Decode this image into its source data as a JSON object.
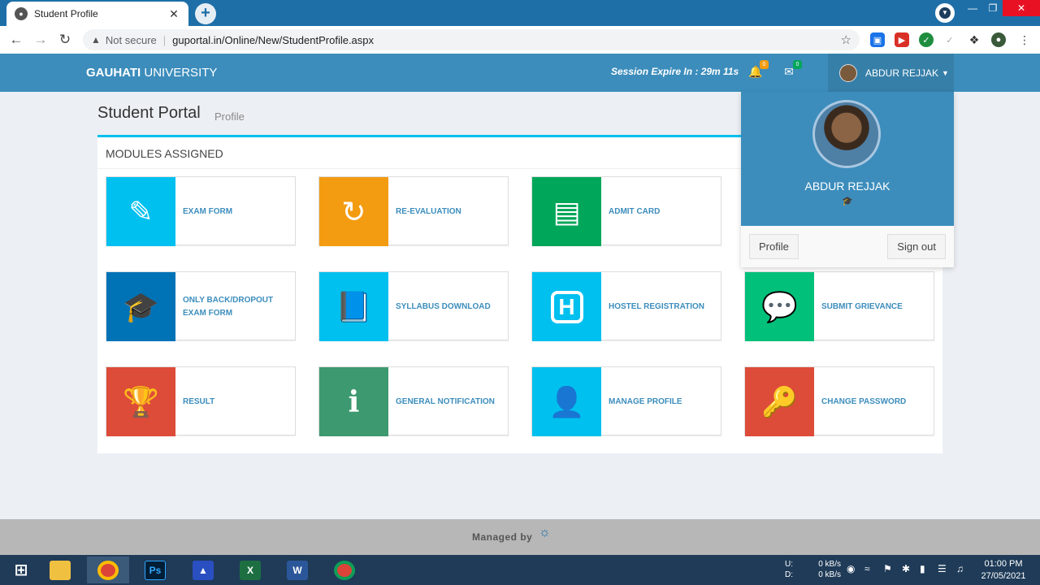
{
  "browser": {
    "tab_title": "Student Profile",
    "security_label": "Not secure",
    "url": "guportal.in/Online/New/StudentProfile.aspx"
  },
  "header": {
    "brand_bold": "GAUHATI",
    "brand_rest": " UNIVERSITY",
    "session_text": "Session Expire In :  29m 11s",
    "notifications_count": "0",
    "messages_count": "0",
    "user_name": "ABDUR REJJAK"
  },
  "page": {
    "title": "Student Portal",
    "subtitle": "Profile",
    "box_title": "MODULES ASSIGNED"
  },
  "modules": [
    {
      "label": "EXAM FORM",
      "color": "#00c0ef"
    },
    {
      "label": "RE-EVALUATION",
      "color": "#f39c12"
    },
    {
      "label": "ADMIT CARD",
      "color": "#00a65a"
    },
    {
      "label": "ONLY BACK/DROPOUT EXAM FORM",
      "color": "#0073b7"
    },
    {
      "label": "SYLLABUS DOWNLOAD",
      "color": "#00c0ef"
    },
    {
      "label": "HOSTEL REGISTRATION",
      "color": "#00c0ef"
    },
    {
      "label": "SUBMIT GRIEVANCE",
      "color": "#00a65a"
    },
    {
      "label": "RESULT",
      "color": "#dd4b39"
    },
    {
      "label": "GENERAL NOTIFICATION",
      "color": "#3d9970"
    },
    {
      "label": "MANAGE PROFILE",
      "color": "#00c0ef"
    },
    {
      "label": "CHANGE PASSWORD",
      "color": "#dd4b39"
    }
  ],
  "dropdown": {
    "name": "ABDUR REJJAK",
    "profile_label": "Profile",
    "signout_label": "Sign out"
  },
  "footer": {
    "managed_by": "Managed by"
  },
  "taskbar": {
    "net_up_label": "U:",
    "net_down_label": "D:",
    "net_up": "0 kB/s",
    "net_down": "0 kB/s",
    "time": "01:00 PM",
    "date": "27/05/2021"
  }
}
